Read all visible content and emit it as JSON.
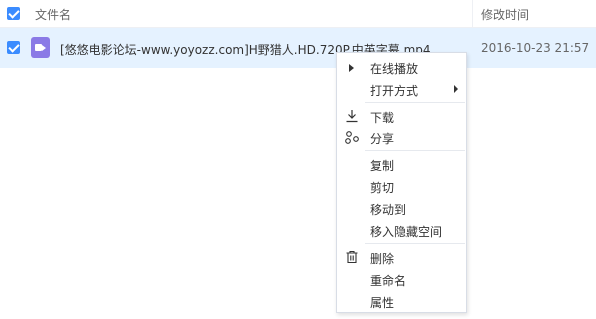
{
  "header": {
    "name_label": "文件名",
    "time_label": "修改时间"
  },
  "file": {
    "name": "[悠悠电影论坛-www.yoyozz.com]H野猎人.HD.720P.中英字幕.mp4",
    "modified": "2016-10-23 21:57",
    "icon": "video-file-icon"
  },
  "context_menu": {
    "play_online": "在线播放",
    "open_with": "打开方式",
    "download": "下载",
    "share": "分享",
    "copy": "复制",
    "cut": "剪切",
    "move_to": "移动到",
    "move_to_hidden": "移入隐藏空间",
    "delete": "删除",
    "rename": "重命名",
    "properties": "属性"
  },
  "colors": {
    "selected_row": "#e5f2ff",
    "checkbox": "#3b8cff",
    "video_icon": "#8a7ae6"
  }
}
